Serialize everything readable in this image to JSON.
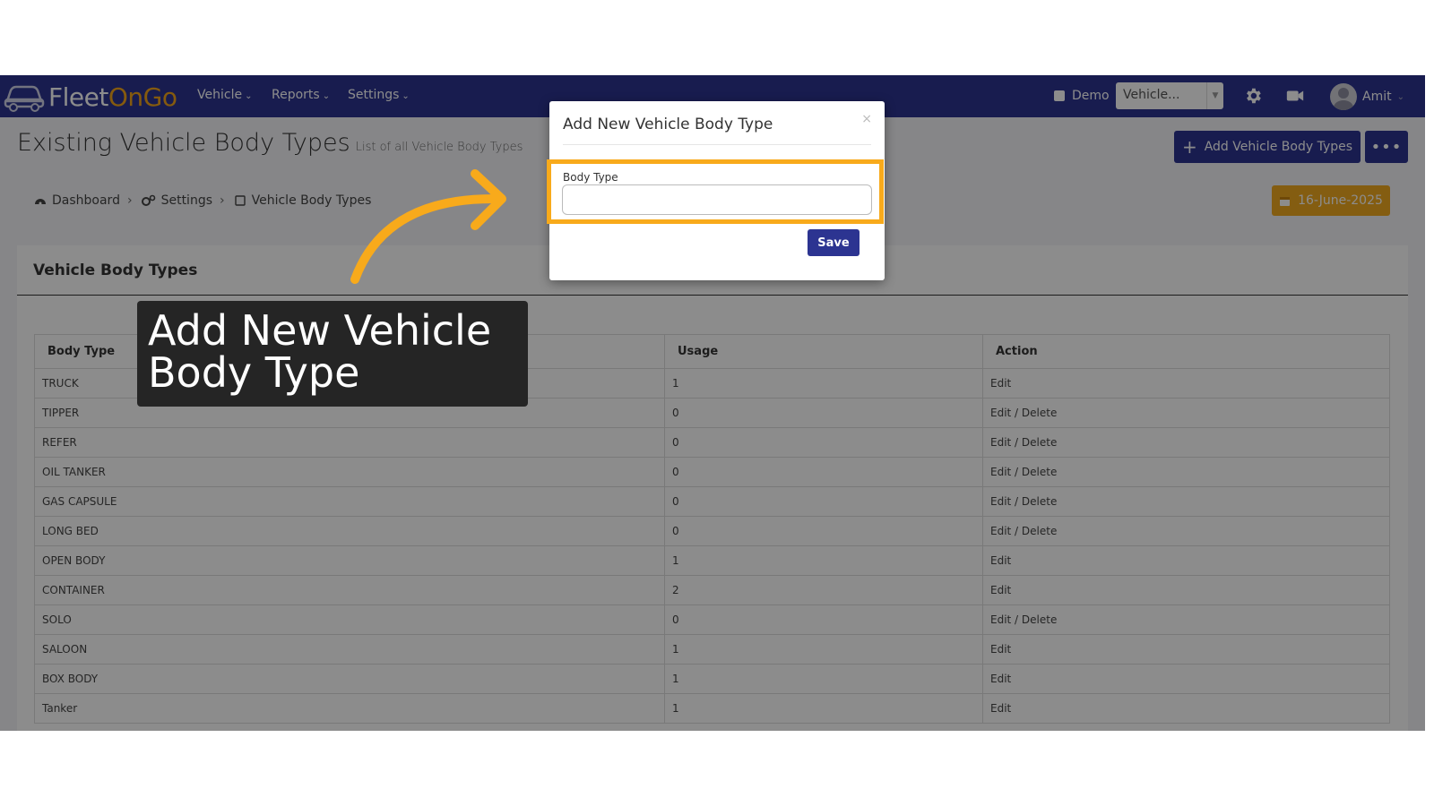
{
  "navbar": {
    "logo_fleet": "Fleet",
    "logo_on": "On",
    "logo_go": "Go",
    "menu": [
      {
        "label": "Vehicle"
      },
      {
        "label": "Reports"
      },
      {
        "label": "Settings"
      }
    ],
    "demo_label": "Demo",
    "vehicle_select_value": "Vehicle...",
    "user_name": "Amit"
  },
  "page": {
    "title": "Existing Vehicle Body Types",
    "subtitle": "List of all Vehicle Body Types",
    "add_button_label": "Add Vehicle Body Types",
    "more_button_label": "•••",
    "date_label": "16-June-2025"
  },
  "breadcrumb": {
    "dashboard": "Dashboard",
    "settings": "Settings",
    "current": "Vehicle Body Types"
  },
  "panel": {
    "title": "Vehicle Body Types"
  },
  "table": {
    "headers": [
      "Body Type",
      "Usage",
      "Action"
    ],
    "rows": [
      [
        "TRUCK",
        "1",
        "Edit"
      ],
      [
        "TIPPER",
        "0",
        "Edit / Delete"
      ],
      [
        "REFER",
        "0",
        "Edit / Delete"
      ],
      [
        "OIL TANKER",
        "0",
        "Edit / Delete"
      ],
      [
        "GAS CAPSULE",
        "0",
        "Edit / Delete"
      ],
      [
        "LONG BED",
        "0",
        "Edit / Delete"
      ],
      [
        "OPEN BODY",
        "1",
        "Edit"
      ],
      [
        "CONTAINER",
        "2",
        "Edit"
      ],
      [
        "SOLO",
        "0",
        "Edit / Delete"
      ],
      [
        "SALOON",
        "1",
        "Edit"
      ],
      [
        "BOX BODY",
        "1",
        "Edit"
      ],
      [
        "Tanker",
        "1",
        "Edit"
      ]
    ]
  },
  "modal": {
    "title": "Add New Vehicle Body Type",
    "close": "×",
    "field_label": "Body Type",
    "field_value": "",
    "save_label": "Save"
  },
  "callout": {
    "text": "Add New Vehicle Body Type"
  },
  "colors": {
    "navbar": "#2c3491",
    "accent_orange": "#f8aa1b",
    "date_button": "#f0a91f"
  }
}
